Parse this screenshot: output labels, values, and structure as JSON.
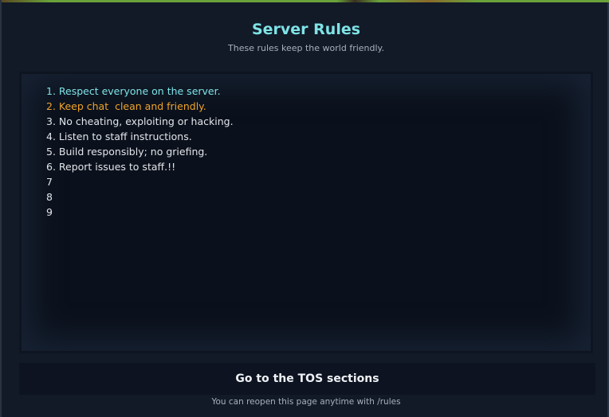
{
  "header": {
    "title": "Server Rules",
    "subtitle": "These rules keep the world friendly."
  },
  "rules": [
    {
      "text": "1. Respect everyone on the server.",
      "color": "#7fe3e6"
    },
    {
      "text": "2. Keep chat  clean and friendly.",
      "color": "#f0a32b"
    },
    {
      "text": "3. No cheating, exploiting or hacking.",
      "color": "#e2e5ea"
    },
    {
      "text": "4. Listen to staff instructions.",
      "color": "#e2e5ea"
    },
    {
      "text": "5. Build responsibly; no griefing.",
      "color": "#e2e5ea"
    },
    {
      "text": "6. Report issues to staff.!!",
      "color": "#e2e5ea"
    },
    {
      "text": "7",
      "color": "#e2e5ea"
    },
    {
      "text": "8",
      "color": "#e2e5ea"
    },
    {
      "text": "9",
      "color": "#e2e5ea"
    }
  ],
  "tos_button": {
    "label": "Go to the TOS sections"
  },
  "footer": {
    "note": "You can reopen this page anytime with /rules"
  }
}
